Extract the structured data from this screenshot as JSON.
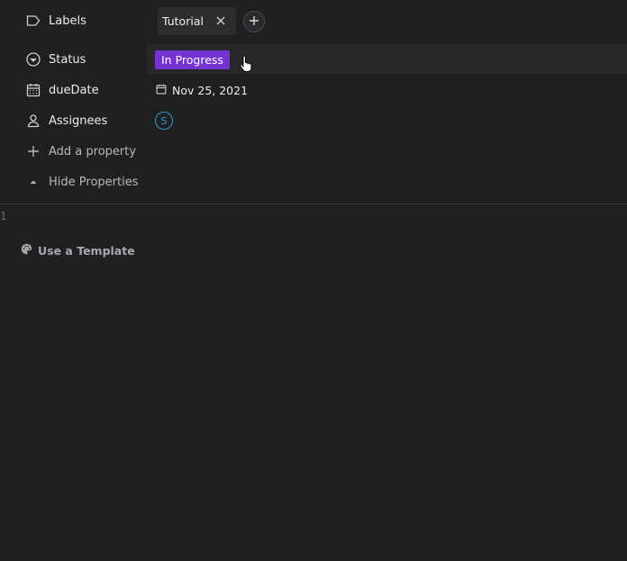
{
  "properties": {
    "labels": {
      "key": "Labels",
      "tags": [
        "Tutorial"
      ],
      "add_icon": "plus-icon"
    },
    "status": {
      "key": "Status",
      "value": "In Progress",
      "badge_color": "#7533d3"
    },
    "due_date": {
      "key": "dueDate",
      "value": "Nov 25, 2021"
    },
    "assignees": {
      "key": "Assignees",
      "avatar_initial": "S",
      "avatar_color": "#2f9bc7"
    },
    "add_property": {
      "label": "Add a property"
    },
    "hide_properties": {
      "label": "Hide Properties"
    }
  },
  "editor": {
    "line_number": "1",
    "template_label": "Use a Template"
  },
  "colors": {
    "background": "#202022",
    "accent_purple": "#7533d3",
    "avatar_blue": "#2f9bc7"
  }
}
